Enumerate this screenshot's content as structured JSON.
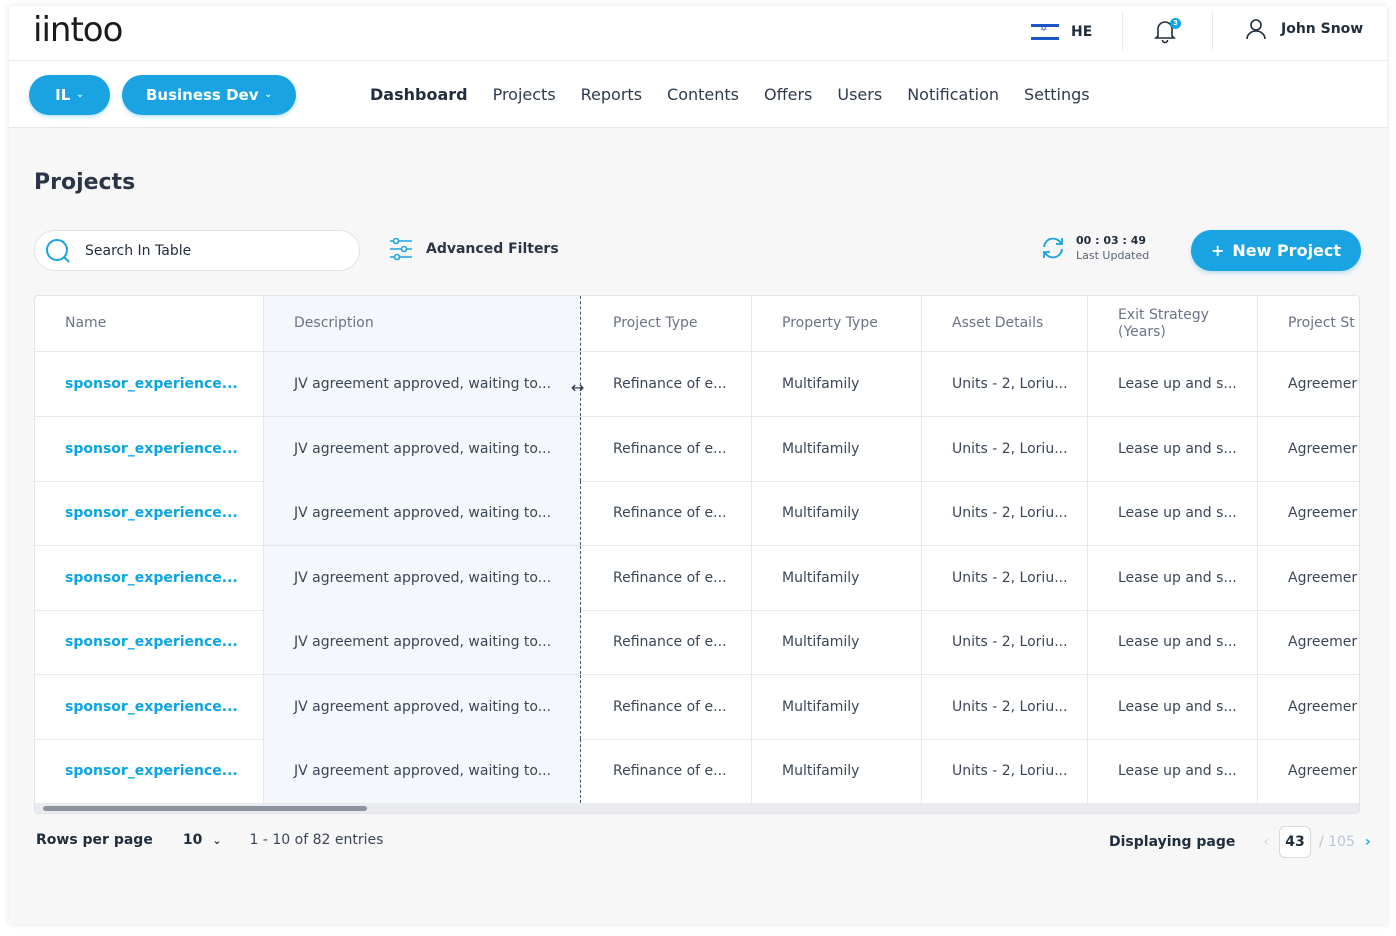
{
  "header": {
    "logo": "iintoo",
    "language": "HE",
    "notification_count": "3",
    "user_name": "John Snow"
  },
  "nav": {
    "country_pill": "IL",
    "team_pill": "Business Dev",
    "links": [
      "Dashboard",
      "Projects",
      "Reports",
      "Contents",
      "Offers",
      "Users",
      "Notification",
      "Settings"
    ],
    "active": "Dashboard"
  },
  "page": {
    "title": "Projects",
    "search_placeholder": "Search In Table",
    "advanced_filters": "Advanced Filters",
    "last_updated_time": "00 : 03 : 49",
    "last_updated_label": "Last Updated",
    "new_project": "New Project"
  },
  "table": {
    "columns": [
      "Name",
      "Description",
      "Project Type",
      "Property Type",
      "Asset Details",
      "Exit Strategy (Years)",
      "Project St"
    ],
    "rows": [
      [
        "sponsor_experience...",
        "JV agreement approved, waiting to...",
        "Refinance of e...",
        "Multifamily",
        "Units - 2, Loriu...",
        "Lease up and s...",
        "Agreemer"
      ],
      [
        "sponsor_experience...",
        "JV agreement approved, waiting to...",
        "Refinance of e...",
        "Multifamily",
        "Units - 2, Loriu...",
        "Lease up and s...",
        "Agreemer"
      ],
      [
        "sponsor_experience...",
        "JV agreement approved, waiting to...",
        "Refinance of e...",
        "Multifamily",
        "Units - 2, Loriu...",
        "Lease up and s...",
        "Agreemer"
      ],
      [
        "sponsor_experience...",
        "JV agreement approved, waiting to...",
        "Refinance of e...",
        "Multifamily",
        "Units - 2, Loriu...",
        "Lease up and s...",
        "Agreemer"
      ],
      [
        "sponsor_experience...",
        "JV agreement approved, waiting to...",
        "Refinance of e...",
        "Multifamily",
        "Units - 2, Loriu...",
        "Lease up and s...",
        "Agreemer"
      ],
      [
        "sponsor_experience...",
        "JV agreement approved, waiting to...",
        "Refinance of e...",
        "Multifamily",
        "Units - 2, Loriu...",
        "Lease up and s...",
        "Agreemer"
      ],
      [
        "sponsor_experience...",
        "JV agreement approved, waiting to...",
        "Refinance of e...",
        "Multifamily",
        "Units - 2, Loriu...",
        "Lease up and s...",
        "Agreemer"
      ]
    ]
  },
  "footer": {
    "rows_per_page_label": "Rows per page",
    "rows_per_page_value": "10",
    "entries": "1 - 10 of 82 entries",
    "displaying_label": "Displaying page",
    "current_page": "43",
    "total_pages": "/ 105"
  },
  "colors": {
    "accent": "#1aa3e3",
    "link": "#0aa5e6",
    "background": "#f7f7f8"
  }
}
